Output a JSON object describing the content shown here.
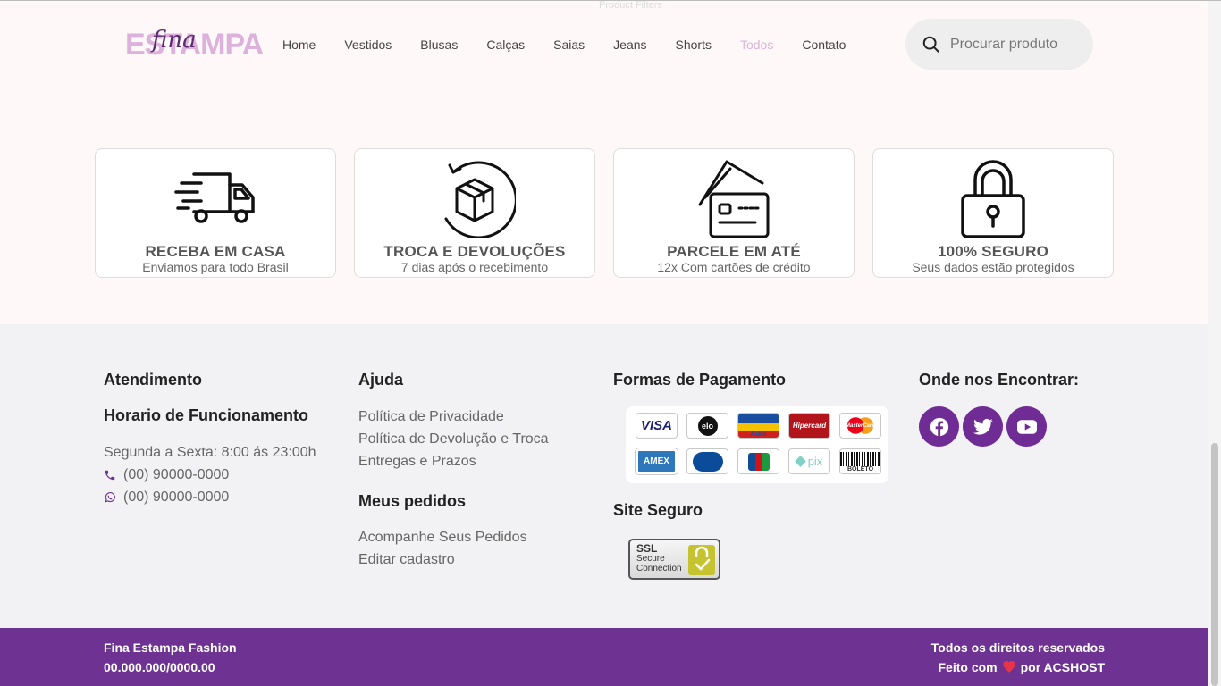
{
  "overlay_label": "Product Filters",
  "brand": {
    "word": "ESTAMPA",
    "script": "fina"
  },
  "nav": [
    "Home",
    "Vestidos",
    "Blusas",
    "Calças",
    "Saias",
    "Jeans",
    "Shorts",
    "Todos",
    "Contato"
  ],
  "nav_active": "Todos",
  "search": {
    "placeholder": "Procurar produto"
  },
  "features": [
    {
      "icon": "delivery-truck-icon",
      "title": "RECEBA EM CASA",
      "subtitle": "Enviamos para todo Brasil"
    },
    {
      "icon": "box-return-icon",
      "title": "TROCA E DEVOLUÇÕES",
      "subtitle": "7 dias após o recebimento"
    },
    {
      "icon": "credit-cards-icon",
      "title": "PARCELE EM ATÉ",
      "subtitle": "12x Com cartões de crédito"
    },
    {
      "icon": "padlock-icon",
      "title": "100% SEGURO",
      "subtitle": "Seus dados estão protegidos"
    }
  ],
  "footer": {
    "atendimento": {
      "title": "Atendimento",
      "subtitle": "Horario de Funcionamento",
      "hours": "Segunda a Sexta: 8:00 ás 23:00h",
      "phone": "(00) 90000-0000",
      "whatsapp": "(00) 90000-0000"
    },
    "ajuda": {
      "title": "Ajuda",
      "links": [
        "Política de Privacidade",
        "Política de Devolução e Troca",
        "Entregas e Prazos"
      ]
    },
    "pedidos": {
      "title": "Meus pedidos",
      "links": [
        "Acompanhe Seus Pedidos",
        "Editar cadastro"
      ]
    },
    "pagamento": {
      "title": "Formas de Pagamento",
      "methods": [
        "VISA",
        "elo",
        "Aura",
        "Hipercard",
        "MasterCard",
        "AMEX",
        "Diners",
        "JCB",
        "pix",
        "BOLETO"
      ]
    },
    "seguro": {
      "title": "Site Seguro",
      "badge_line1": "SSL",
      "badge_line2": "Secure",
      "badge_line3": "Connection"
    },
    "social": {
      "title": "Onde nos Encontrar:",
      "networks": [
        "facebook-icon",
        "twitter-icon",
        "youtube-icon"
      ]
    }
  },
  "bottom_bar": {
    "company": "Fina Estampa Fashion",
    "cnpj": "00.000.000/0000.00",
    "rights": "Todos os direitos reservados",
    "made_prefix": "Feito com",
    "made_suffix": "por ACSHOST"
  },
  "colors": {
    "brand_purple": "#6e3392",
    "logo_pink": "#dcb1db",
    "active_nav": "#d9b4d8",
    "hero_bg": "#fff8f8",
    "footer_bg": "#f2f2f4"
  }
}
